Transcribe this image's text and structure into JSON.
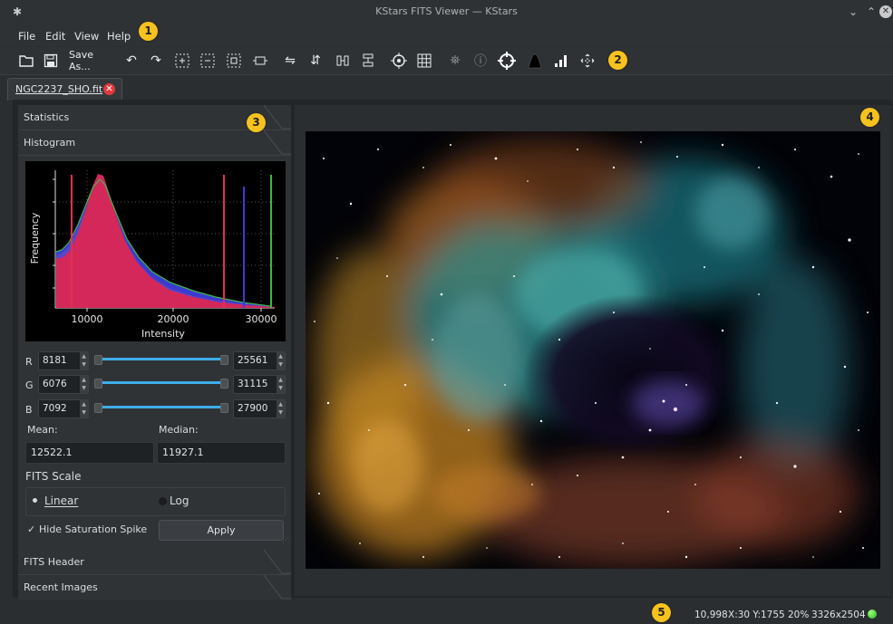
{
  "window": {
    "title": "KStars FITS Viewer — KStars"
  },
  "menu": [
    {
      "label": "File",
      "accel": "F"
    },
    {
      "label": "Edit",
      "accel": "E"
    },
    {
      "label": "View",
      "accel": "V"
    },
    {
      "label": "Help",
      "accel": "H"
    }
  ],
  "toolbar": {
    "save_as_label": "Save As...",
    "icons": [
      "open-icon",
      "save-icon",
      "undo-icon",
      "redo-icon",
      "zoom-in-icon",
      "zoom-out-icon",
      "zoom-fit-icon",
      "zoom-default-icon",
      "flip-h-icon",
      "flip-v-icon",
      "rotate-ccw-icon",
      "rotate-cw-icon",
      "crosshair-icon",
      "grid-icon",
      "star-detect-icon",
      "info-icon",
      "target-icon",
      "autostretch-icon",
      "histogram-icon",
      "pan-icon"
    ]
  },
  "badges": [
    "1",
    "2",
    "3",
    "4",
    "5"
  ],
  "tab": {
    "label": "NGC2237_SHO.fit"
  },
  "sections": {
    "statistics": "Statistics",
    "histogram": "Histogram",
    "fits_header": "FITS Header",
    "recent_images": "Recent Images"
  },
  "histogram": {
    "ylabel": "Frequency",
    "xlabel": "Intensity",
    "xticks": [
      "10000",
      "20000",
      "30000"
    ],
    "colors": {
      "red": "#e0304e",
      "green": "#3fb54a",
      "blue": "#4a4ed8"
    }
  },
  "channels": [
    {
      "name": "R",
      "min": "8181",
      "max": "25561"
    },
    {
      "name": "G",
      "min": "6076",
      "max": "31115"
    },
    {
      "name": "B",
      "min": "7092",
      "max": "27900"
    }
  ],
  "stats": {
    "mean_label": "Mean:",
    "median_label": "Median:",
    "mean": "12522.1",
    "median": "11927.1"
  },
  "fits_scale": {
    "title": "FITS Scale",
    "linear": "Linear",
    "log": "Log",
    "selected": "Linear"
  },
  "hide_spike": {
    "label": "Hide Saturation Spike",
    "checked": true
  },
  "apply_label": "Apply",
  "status": {
    "pixel_value": "10,998",
    "coords": "X:30 Y:1755",
    "zoom": "20%",
    "dimensions": "3326x2504"
  }
}
